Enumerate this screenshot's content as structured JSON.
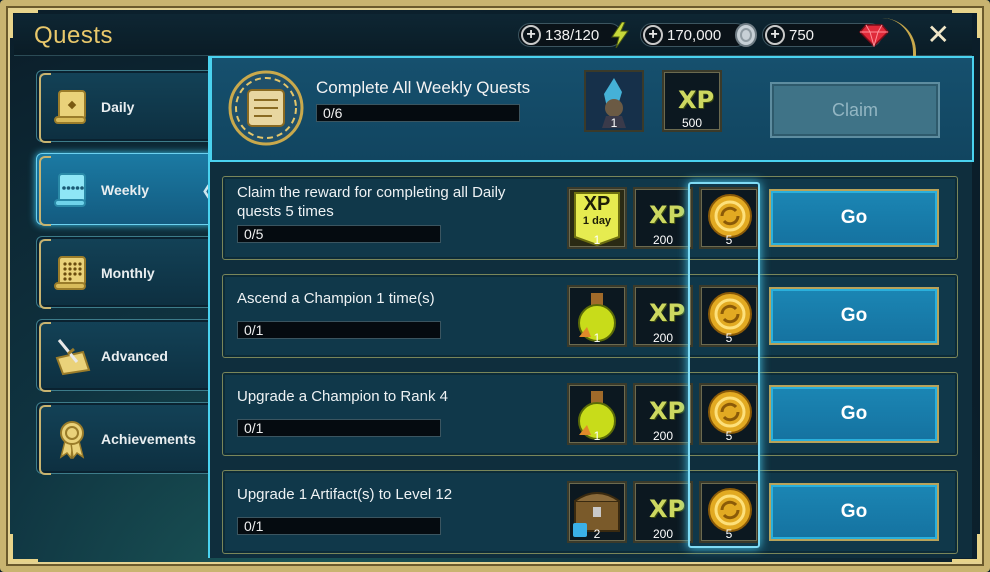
{
  "header": {
    "title": "Quests",
    "resources": [
      {
        "value": "138/120",
        "icon": "energy-bolt-icon",
        "color": "#c7d83a"
      },
      {
        "value": "170,000",
        "icon": "silver-coin-icon",
        "color": "#b8c4cc"
      },
      {
        "value": "750",
        "icon": "ruby-gem-icon",
        "color": "#e02a3a"
      }
    ],
    "close": "✕"
  },
  "sidebar": {
    "items": [
      {
        "label": "Daily",
        "icon": "scroll-icon"
      },
      {
        "label": "Weekly",
        "icon": "weekly-scroll-icon",
        "active": true
      },
      {
        "label": "Monthly",
        "icon": "monthly-scroll-icon"
      },
      {
        "label": "Advanced",
        "icon": "sword-map-icon"
      },
      {
        "label": "Achievements",
        "icon": "medal-ribbon-icon"
      }
    ]
  },
  "top": {
    "title": "Complete All Weekly Quests",
    "progress": "0/6",
    "reward1_count": "1",
    "reward2_label": "XP",
    "reward2_count": "500",
    "claim_label": "Claim"
  },
  "quests": [
    {
      "title": "Claim the reward for completing all Daily quests 5 times",
      "progress": "0/5",
      "reward1": {
        "type": "xp-boost",
        "label": "XP",
        "sub": "1 day",
        "count": "1"
      },
      "xp": "200",
      "coins": "5",
      "go": "Go"
    },
    {
      "title": "Ascend a Champion 1 time(s)",
      "progress": "0/1",
      "reward1": {
        "type": "potion",
        "count": "1"
      },
      "xp": "200",
      "coins": "5",
      "go": "Go"
    },
    {
      "title": "Upgrade a Champion to Rank 4",
      "progress": "0/1",
      "reward1": {
        "type": "potion",
        "count": "1"
      },
      "xp": "200",
      "coins": "5",
      "go": "Go"
    },
    {
      "title": "Upgrade 1 Artifact(s) to Level 12",
      "progress": "0/1",
      "reward1": {
        "type": "chest",
        "count": "2"
      },
      "xp": "200",
      "coins": "5",
      "go": "Go"
    }
  ],
  "xp_label": "XP"
}
